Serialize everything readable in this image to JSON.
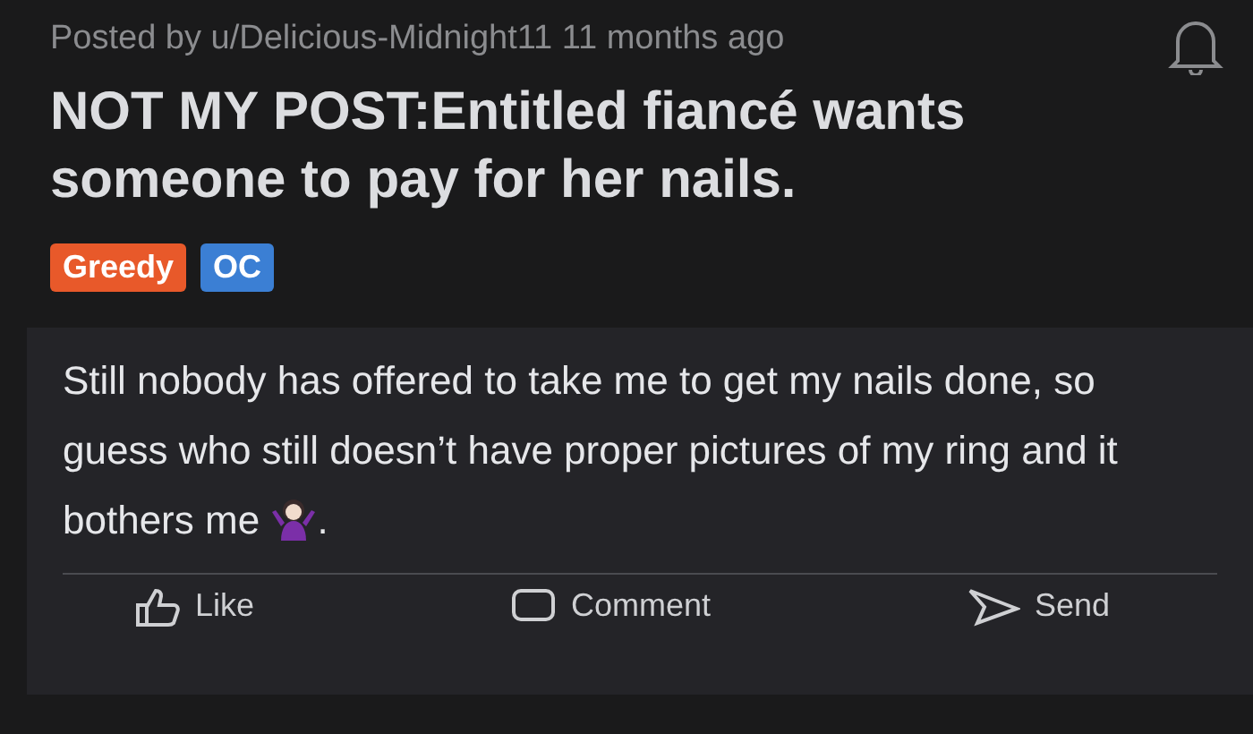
{
  "post": {
    "byline": "Posted by u/Delicious-Midnight11 11 months ago",
    "title": "NOT MY POST:Entitled fiancé wants someone to pay for her nails.",
    "flairs": [
      {
        "label": "Greedy",
        "color": "#e8592a"
      },
      {
        "label": "OC",
        "color": "#3b7fd4"
      }
    ]
  },
  "quoted_post": {
    "body": "Still nobody has offered to take me to get my nails done, so guess who still doesn’t have proper pictures of my ring and it bothers me",
    "body_end": ".",
    "actions": [
      {
        "kind": "like",
        "label": "Like"
      },
      {
        "kind": "comment",
        "label": "Comment"
      },
      {
        "kind": "send",
        "label": "Send"
      }
    ]
  }
}
